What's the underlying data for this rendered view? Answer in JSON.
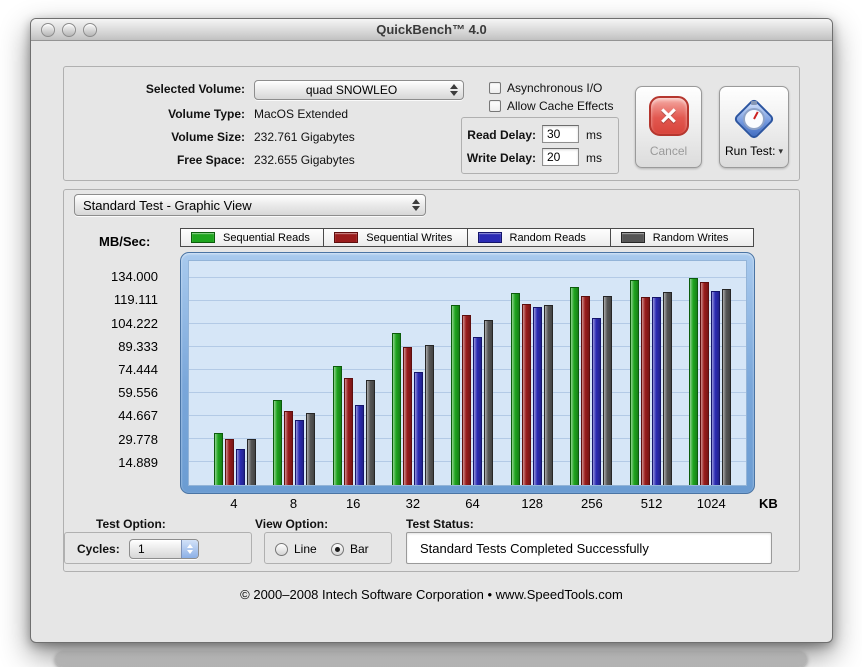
{
  "window": {
    "title": "QuickBench™ 4.0"
  },
  "icons": {
    "cancel_x": "✕",
    "dropdown_arrow": "▾"
  },
  "volume_panel": {
    "selected_volume_label": "Selected Volume:",
    "selected_volume_value": "quad SNOWLEO",
    "volume_type_label": "Volume Type:",
    "volume_type_value": "MacOS Extended",
    "volume_size_label": "Volume Size:",
    "volume_size_value": "232.761 Gigabytes",
    "free_space_label": "Free Space:",
    "free_space_value": "232.655 Gigabytes",
    "async_io_label": "Asynchronous I/O",
    "cache_effects_label": "Allow Cache Effects",
    "read_delay_label": "Read Delay:",
    "read_delay_value": "30",
    "read_delay_unit": "ms",
    "write_delay_label": "Write Delay:",
    "write_delay_value": "20",
    "write_delay_unit": "ms",
    "cancel_label": "Cancel",
    "run_test_label": "Run Test:"
  },
  "view_selector": {
    "value": "Standard Test - Graphic View"
  },
  "chart_data": {
    "type": "bar",
    "ylabel": "MB/Sec:",
    "xunit": "KB",
    "ylim": [
      0,
      145
    ],
    "grid": true,
    "legend_position": "top",
    "categories": [
      "4",
      "8",
      "16",
      "32",
      "64",
      "128",
      "256",
      "512",
      "1024"
    ],
    "y_ticks": [
      "134.000",
      "119.111",
      "104.222",
      "89.333",
      "74.444",
      "59.556",
      "44.667",
      "29.778",
      "14.889"
    ],
    "series": [
      {
        "name": "Sequential Reads",
        "color": "#1ea51e",
        "edge": "#0b5c0b",
        "values": [
          33.5,
          55,
          77,
          98.5,
          116.5,
          124.5,
          128,
          133,
          134
        ]
      },
      {
        "name": "Sequential Writes",
        "color": "#9a1c1c",
        "edge": "#5e0e0e",
        "values": [
          30,
          48,
          69,
          89.5,
          110,
          117,
          122.5,
          121.5,
          131.5
        ]
      },
      {
        "name": "Random Reads",
        "color": "#2b2bb4",
        "edge": "#15156b",
        "values": [
          23,
          42,
          52,
          73,
          96,
          115,
          108,
          122,
          125.5
        ]
      },
      {
        "name": "Random Writes",
        "color": "#565656",
        "edge": "#262626",
        "values": [
          30,
          46.5,
          68,
          90.5,
          107,
          116.5,
          122.5,
          125,
          127
        ]
      }
    ]
  },
  "bottom": {
    "test_option_label": "Test Option:",
    "cycles_label": "Cycles:",
    "cycles_value": "1",
    "view_option_label": "View Option:",
    "line_label": "Line",
    "bar_label": "Bar",
    "view_selected": "Bar",
    "test_status_label": "Test Status:",
    "test_status_value": "Standard Tests Completed Successfully"
  },
  "footer": "© 2000–2008 Intech Software Corporation • www.SpeedTools.com"
}
